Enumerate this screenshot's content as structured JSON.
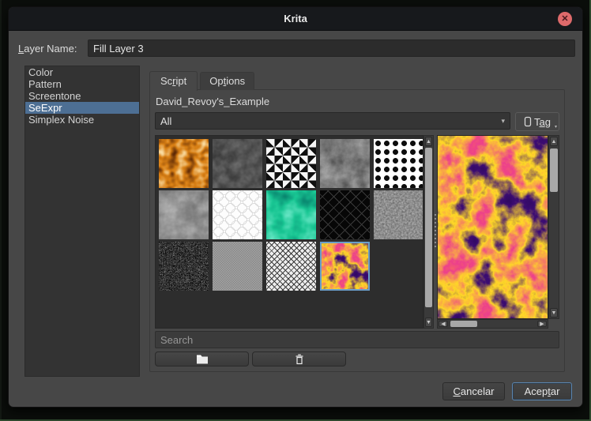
{
  "window": {
    "title": "Krita"
  },
  "layer_name_row": {
    "label": "Layer Name:",
    "mnemonic": "L",
    "value": "Fill Layer 3"
  },
  "generator_list": {
    "items": [
      "Color",
      "Pattern",
      "Screentone",
      "SeExpr",
      "Simplex Noise"
    ],
    "selected_index": 3
  },
  "tabs": {
    "script": {
      "label": "Script",
      "mnemonic": "r",
      "active": true
    },
    "options": {
      "label": "Options",
      "mnemonic": "t",
      "active": false
    }
  },
  "script_panel": {
    "resource_label": "David_Revoy's_Example",
    "tag_filter_value": "All",
    "tag_button": {
      "label": "Tag",
      "mnemonic": "a",
      "icon": "bookmark-icon"
    },
    "search_placeholder": "Search",
    "action_icons": [
      "folder-icon",
      "trash-icon"
    ]
  },
  "gallery": {
    "thumbnails": [
      {
        "texture": "amber-cells"
      },
      {
        "texture": "charcoal-swirls"
      },
      {
        "texture": "bw-triangles"
      },
      {
        "texture": "gray-marble"
      },
      {
        "texture": "halftone-dots"
      },
      {
        "texture": "smoke-clouds"
      },
      {
        "texture": "ring-lattice"
      },
      {
        "texture": "green-marble"
      },
      {
        "texture": "dark-maze"
      },
      {
        "texture": "fine-grain"
      },
      {
        "texture": "static-noise"
      },
      {
        "texture": "gray-dither"
      },
      {
        "texture": "diagonal-dither"
      },
      {
        "texture": "magma",
        "selected": true
      }
    ],
    "preview": {
      "texture": "magma"
    }
  },
  "dialog_buttons": {
    "cancel": {
      "label": "Cancelar",
      "mnemonic": "C"
    },
    "accept": {
      "label": "Aceptar",
      "mnemonic": "t",
      "default": true
    }
  },
  "colors": {
    "selection_blue": "#4d6f94",
    "thumbnail_selected_border": "#6b9ec9",
    "close_button_red": "#de6a6b",
    "magma_purple": "#3a0a6e",
    "magma_pink": "#ed3d93",
    "magma_yellow": "#ffd92e",
    "dialog_background": "#474747"
  }
}
